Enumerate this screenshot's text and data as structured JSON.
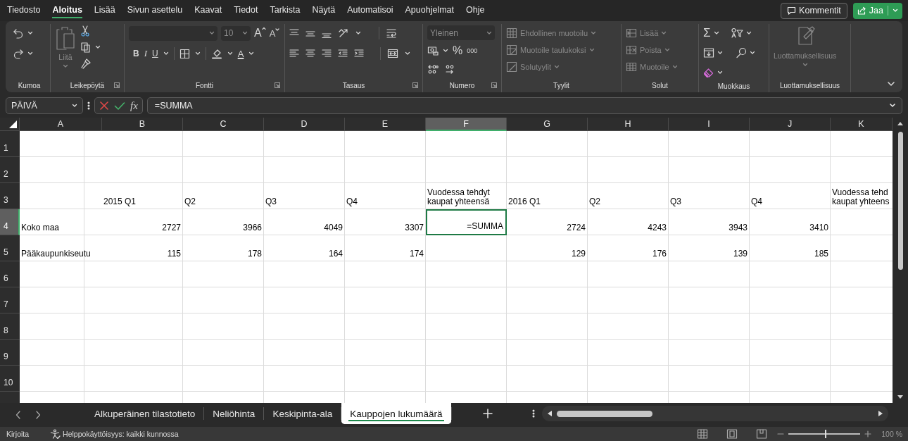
{
  "menu_tabs": [
    {
      "label": "Tiedosto",
      "selected": false
    },
    {
      "label": "Aloitus",
      "selected": true
    },
    {
      "label": "Lisää",
      "selected": false
    },
    {
      "label": "Sivun asettelu",
      "selected": false
    },
    {
      "label": "Kaavat",
      "selected": false
    },
    {
      "label": "Tiedot",
      "selected": false
    },
    {
      "label": "Tarkista",
      "selected": false
    },
    {
      "label": "Näytä",
      "selected": false
    },
    {
      "label": "Automatisoi",
      "selected": false
    },
    {
      "label": "Apuohjelmat",
      "selected": false
    },
    {
      "label": "Ohje",
      "selected": false
    }
  ],
  "comment_button": "Kommentit",
  "share_button": "Jaa",
  "ribbon": {
    "groups": [
      {
        "label": "Kumoa"
      },
      {
        "label": "Leikepöytä",
        "buttons": [
          {
            "label": "Liitä",
            "disabled": true
          }
        ]
      },
      {
        "label": "Fontti",
        "font_size": "10",
        "glyphs": [
          "A",
          "A",
          "B",
          "I",
          "U",
          "A"
        ]
      },
      {
        "label": "Tasaus"
      },
      {
        "label": "Numero",
        "format": "Yleinen",
        "glyphs": [
          "%",
          "000"
        ]
      },
      {
        "label": "Tyylit",
        "buttons": [
          {
            "label": "Ehdollinen muotoilu",
            "disabled": true
          },
          {
            "label": "Muotoile taulukoksi",
            "disabled": true
          },
          {
            "label": "Solutyylit",
            "disabled": true
          }
        ]
      },
      {
        "label": "Solut",
        "buttons": [
          {
            "label": "Lisää",
            "disabled": true
          },
          {
            "label": "Poista",
            "disabled": true
          },
          {
            "label": "Muotoile",
            "disabled": true
          }
        ]
      },
      {
        "label": "Muokkaus",
        "glyphs": [
          "Σ"
        ]
      },
      {
        "label": "Luottamuksellisuus",
        "buttons": [
          {
            "label": "Luottamuksellisuus",
            "disabled": true
          }
        ]
      }
    ]
  },
  "formula_bar": {
    "name_box": "PÄIVÄ",
    "function_glyph": "fx",
    "formula": "=SUMMA"
  },
  "sheet": {
    "columns": [
      {
        "label": "A",
        "selected": false
      },
      {
        "label": "B",
        "selected": false
      },
      {
        "label": "C",
        "selected": false
      },
      {
        "label": "D",
        "selected": false
      },
      {
        "label": "E",
        "selected": false
      },
      {
        "label": "F",
        "selected": true
      },
      {
        "label": "G",
        "selected": false
      },
      {
        "label": "H",
        "selected": false
      },
      {
        "label": "I",
        "selected": false
      },
      {
        "label": "J",
        "selected": false
      },
      {
        "label": "K",
        "selected": false
      }
    ],
    "rows": [
      {
        "label": "1",
        "selected": false,
        "cells": [
          null,
          null,
          null,
          null,
          null,
          null,
          null,
          null,
          null,
          null,
          null
        ]
      },
      {
        "label": "2",
        "selected": false,
        "cells": [
          null,
          null,
          null,
          null,
          null,
          null,
          null,
          null,
          null,
          null,
          null
        ]
      },
      {
        "label": "3",
        "selected": false,
        "cells": [
          null,
          {
            "text": "2015 Q1",
            "kind": "label",
            "selected": false
          },
          {
            "text": "Q2",
            "kind": "label",
            "selected": false
          },
          {
            "text": "Q3",
            "kind": "label",
            "selected": false
          },
          {
            "text": "Q4",
            "kind": "label",
            "selected": false
          },
          {
            "text": "Vuodessa tehdyt kaupat yhteensä",
            "kind": "label",
            "selected": false
          },
          {
            "text": "2016 Q1",
            "kind": "label",
            "selected": false
          },
          {
            "text": "Q2",
            "kind": "label",
            "selected": false
          },
          {
            "text": "Q3",
            "kind": "label",
            "selected": false
          },
          {
            "text": "Q4",
            "kind": "label",
            "selected": false
          },
          {
            "text": "Vuodessa tehd\nkaupat yhteens",
            "kind": "label",
            "selected": false
          }
        ]
      },
      {
        "label": "4",
        "selected": true,
        "cells": [
          {
            "text": "Koko maa",
            "kind": "label",
            "selected": false
          },
          {
            "text": "2727",
            "kind": "number",
            "selected": false
          },
          {
            "text": "3966",
            "kind": "number",
            "selected": false
          },
          {
            "text": "4049",
            "kind": "number",
            "selected": false
          },
          {
            "text": "3307",
            "kind": "number",
            "selected": false
          },
          {
            "text": "=SUMMA",
            "kind": "formula",
            "selected": true
          },
          {
            "text": "2724",
            "kind": "number",
            "selected": false
          },
          {
            "text": "4243",
            "kind": "number",
            "selected": false
          },
          {
            "text": "3943",
            "kind": "number",
            "selected": false
          },
          {
            "text": "3410",
            "kind": "number",
            "selected": false
          },
          null
        ]
      },
      {
        "label": "5",
        "selected": false,
        "cells": [
          {
            "text": "Pääkaupunkiseutu",
            "kind": "label",
            "selected": false
          },
          {
            "text": "115",
            "kind": "number",
            "selected": false
          },
          {
            "text": "178",
            "kind": "number",
            "selected": false
          },
          {
            "text": "164",
            "kind": "number",
            "selected": false
          },
          {
            "text": "174",
            "kind": "number",
            "selected": false
          },
          null,
          {
            "text": "129",
            "kind": "number",
            "selected": false
          },
          {
            "text": "176",
            "kind": "number",
            "selected": false
          },
          {
            "text": "139",
            "kind": "number",
            "selected": false
          },
          {
            "text": "185",
            "kind": "number",
            "selected": false
          },
          null
        ]
      },
      {
        "label": "6",
        "selected": false,
        "cells": [
          null,
          null,
          null,
          null,
          null,
          null,
          null,
          null,
          null,
          null,
          null
        ]
      },
      {
        "label": "7",
        "selected": false,
        "cells": [
          null,
          null,
          null,
          null,
          null,
          null,
          null,
          null,
          null,
          null,
          null
        ]
      },
      {
        "label": "8",
        "selected": false,
        "cells": [
          null,
          null,
          null,
          null,
          null,
          null,
          null,
          null,
          null,
          null,
          null
        ]
      },
      {
        "label": "9",
        "selected": false,
        "cells": [
          null,
          null,
          null,
          null,
          null,
          null,
          null,
          null,
          null,
          null,
          null
        ]
      },
      {
        "label": "10",
        "selected": false,
        "cells": [
          null,
          null,
          null,
          null,
          null,
          null,
          null,
          null,
          null,
          null,
          null
        ]
      }
    ]
  },
  "sheet_tabs": [
    {
      "label": "Alkuperäinen tilastotieto",
      "selected": false
    },
    {
      "label": "Neliöhinta",
      "selected": false
    },
    {
      "label": "Keskipinta-ala",
      "selected": false
    },
    {
      "label": "Kauppojen lukumäärä",
      "selected": true
    }
  ],
  "status_bar": {
    "mode": "Kirjoita",
    "accessibility": "Helppokäyttöisyys: kaikki kunnossa",
    "zoom": {
      "level": 0.5,
      "reading": "100 %"
    }
  }
}
